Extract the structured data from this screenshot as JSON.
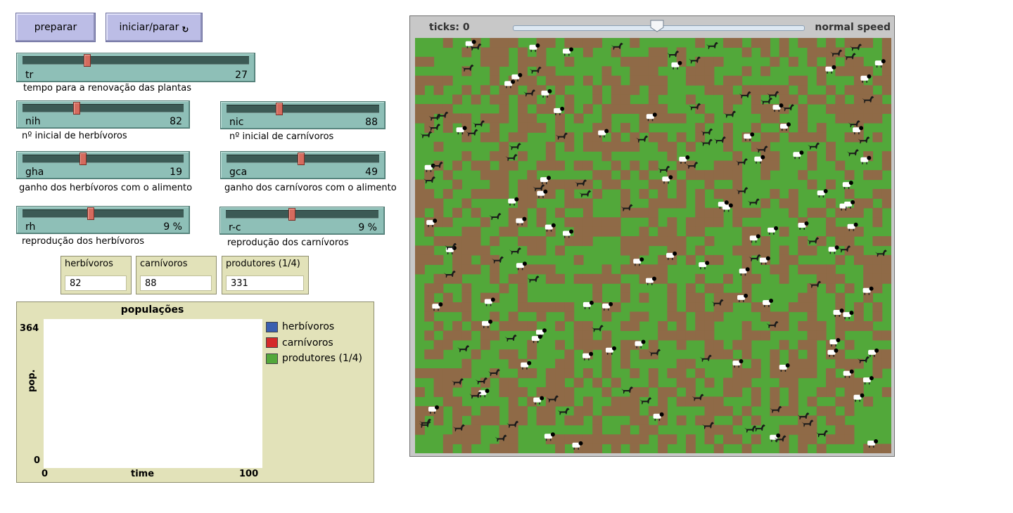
{
  "buttons": {
    "setup": "preparar",
    "go": "iniciar/parar",
    "go_forever_glyph": "forever-icon"
  },
  "sliders": {
    "tr": {
      "name": "tr",
      "value": "27",
      "caption": "tempo para a renovação das plantas",
      "fraction": 0.28
    },
    "nih": {
      "name": "nih",
      "value": "82",
      "caption": "nº inicial de herbívoros",
      "fraction": 0.33
    },
    "nic": {
      "name": "nic",
      "value": "88",
      "caption": "nº inicial de carnívoros",
      "fraction": 0.34
    },
    "gha": {
      "name": "gha",
      "value": "19",
      "caption": "ganho dos herbívoros com o alimento",
      "fraction": 0.37
    },
    "gca": {
      "name": "gca",
      "value": "49",
      "caption": "ganho dos carnívoros com o alimento",
      "fraction": 0.49
    },
    "rh": {
      "name": "rh",
      "value": "9 %",
      "caption": "reprodução dos herbívoros",
      "fraction": 0.42
    },
    "rc": {
      "name": "r-c",
      "value": "9 %",
      "caption": "reprodução dos carnívoros",
      "fraction": 0.43
    }
  },
  "monitors": {
    "herbivoros": {
      "label": "herbívoros",
      "value": "82"
    },
    "carnivoros": {
      "label": "carnívoros",
      "value": "88"
    },
    "produtores": {
      "label": "produtores (1/4)",
      "value": "331"
    }
  },
  "plot": {
    "title": "populações",
    "ylabel": "pop.",
    "xlabel": "time",
    "ymax": "364",
    "ymin": "0",
    "xmin": "0",
    "xmax": "100",
    "legend": [
      {
        "label": "herbívoros",
        "color": "#3a5fb0"
      },
      {
        "label": "carnívoros",
        "color": "#d42a2a"
      },
      {
        "label": "produtores (1/4)",
        "color": "#52a83a"
      }
    ]
  },
  "view": {
    "ticks": "ticks: 0",
    "speed_label": "normal speed",
    "speed": 0.5,
    "colors": {
      "grass": "#52a83a",
      "dirt": "#8f6a47",
      "sheep": "#ffffff",
      "wolf": "#1a1a1a"
    }
  }
}
